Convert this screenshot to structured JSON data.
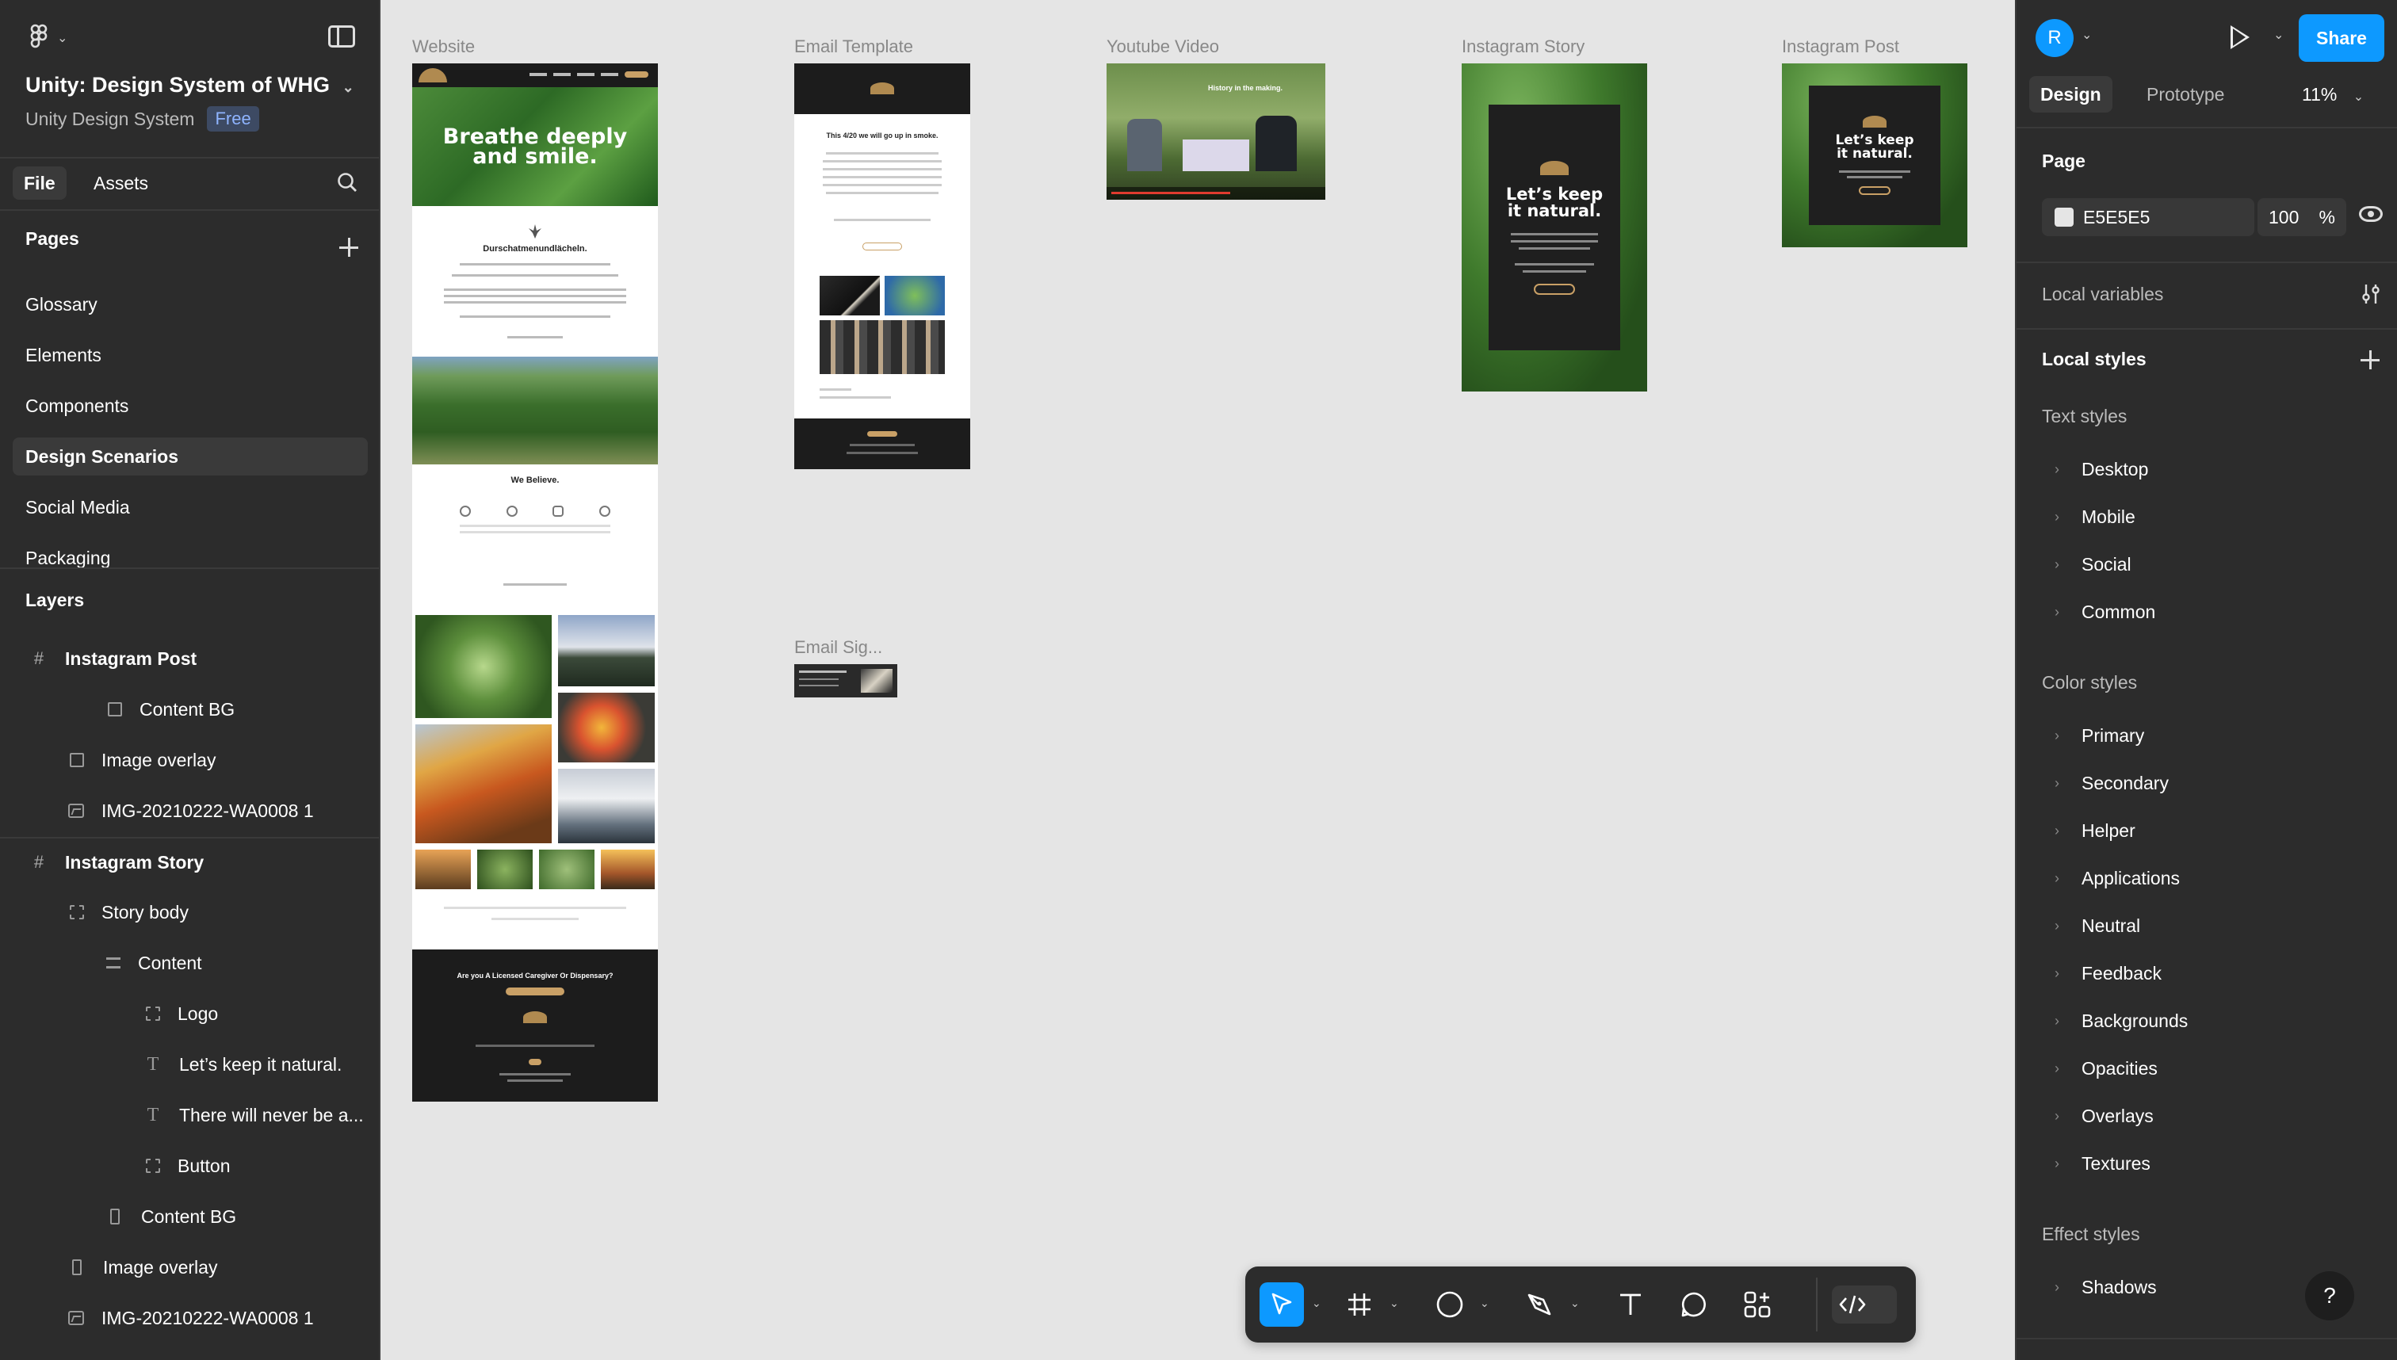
{
  "file": {
    "title": "Unity: Design System of WHG",
    "project": "Unity Design System",
    "plan_badge": "Free"
  },
  "left_tabs": {
    "file": "File",
    "assets": "Assets"
  },
  "pages": {
    "heading": "Pages",
    "items": [
      "Glossary",
      "Elements",
      "Components",
      "Design Scenarios",
      "Social Media",
      "Packaging"
    ],
    "selected": "Design Scenarios"
  },
  "layers": {
    "heading": "Layers",
    "items": [
      {
        "name": "Instagram Post",
        "icon": "frame-icon",
        "indent": 0,
        "bold": true
      },
      {
        "name": "Content BG",
        "icon": "rectangle-icon",
        "indent": 2,
        "bold": false
      },
      {
        "name": "Image overlay",
        "icon": "rectangle-icon",
        "indent": 1,
        "bold": false
      },
      {
        "name": "IMG-20210222-WA0008 1",
        "icon": "image-icon",
        "indent": 1,
        "bold": false
      },
      {
        "name": "Instagram Story",
        "icon": "frame-icon",
        "indent": 0,
        "bold": true
      },
      {
        "name": "Story body",
        "icon": "dashed-frame-icon",
        "indent": 1,
        "bold": false
      },
      {
        "name": "Content",
        "icon": "auto-layout-icon",
        "indent": 2,
        "bold": false
      },
      {
        "name": "Logo",
        "icon": "dashed-frame-icon",
        "indent": 3,
        "bold": false
      },
      {
        "name": "Let’s keep it natural.",
        "icon": "text-icon",
        "indent": 3,
        "bold": false
      },
      {
        "name": "There will never be a...",
        "icon": "text-icon",
        "indent": 3,
        "bold": false
      },
      {
        "name": "Button",
        "icon": "dashed-frame-icon",
        "indent": 3,
        "bold": false
      },
      {
        "name": "Content BG",
        "icon": "tall-rectangle-icon",
        "indent": 2,
        "bold": false
      },
      {
        "name": "Image overlay",
        "icon": "tall-rectangle-icon",
        "indent": 1,
        "bold": false
      },
      {
        "name": "IMG-20210222-WA0008 1",
        "icon": "image-icon",
        "indent": 1,
        "bold": false
      }
    ]
  },
  "canvas": {
    "background": "#E5E5E5",
    "frames": {
      "website": "Website",
      "email_template": "Email Template",
      "youtube_video": "Youtube Video",
      "instagram_story": "Instagram Story",
      "instagram_post": "Instagram Post",
      "email_signature": "Email Sig..."
    },
    "website": {
      "hero": "Breathe deeply and smile.",
      "section_title": "Durschatmenundlächeln.",
      "believe_title": "We Believe.",
      "footer_question": "Are you  A Licensed Caregiver Or Dispensary?"
    },
    "email": {
      "headline": "This 4/20 we will go up in smoke."
    },
    "youtube": {
      "caption": "History in the making."
    },
    "story": {
      "headline": "Let’s keep it natural."
    },
    "post": {
      "headline": "Let’s keep it natural."
    }
  },
  "right_panel": {
    "avatar_initial": "R",
    "share_label": "Share",
    "tabs": {
      "design": "Design",
      "prototype": "Prototype"
    },
    "zoom": "11%",
    "page_heading": "Page",
    "page_color": "E5E5E5",
    "page_opacity": "100",
    "opacity_unit": "%",
    "local_variables": "Local variables",
    "local_styles": "Local styles",
    "text_styles": {
      "heading": "Text styles",
      "items": [
        "Desktop",
        "Mobile",
        "Social",
        "Common"
      ]
    },
    "color_styles": {
      "heading": "Color styles",
      "items": [
        "Primary",
        "Secondary",
        "Helper",
        "Applications",
        "Neutral",
        "Feedback",
        "Backgrounds",
        "Opacities",
        "Overlays",
        "Textures"
      ]
    },
    "effect_styles": {
      "heading": "Effect styles",
      "items": [
        "Shadows"
      ]
    },
    "help": "?"
  },
  "toolbar": {
    "tools": [
      "move-tool",
      "frame-tool",
      "shape-tool",
      "pen-tool",
      "text-tool",
      "comment-tool",
      "actions-tool",
      "dev-mode-toggle"
    ],
    "active_tool": "move-tool",
    "accent": "#0D99FF"
  }
}
